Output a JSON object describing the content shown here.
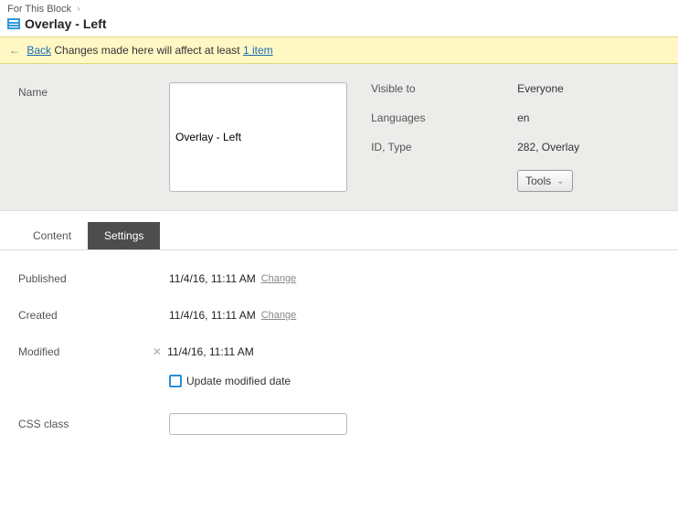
{
  "breadcrumb": {
    "root": "For This Block"
  },
  "page_title": "Overlay - Left",
  "notice": {
    "back_label": "Back",
    "message_prefix": "Changes made here will affect at least",
    "item_link": "1 item"
  },
  "name_field": {
    "label": "Name",
    "value": "Overlay - Left"
  },
  "meta": {
    "visible_label": "Visible to",
    "visible_value": "Everyone",
    "languages_label": "Languages",
    "languages_value": "en",
    "idtype_label": "ID, Type",
    "idtype_value": "282, Overlay"
  },
  "tools_label": "Tools",
  "tabs": {
    "content": "Content",
    "settings": "Settings"
  },
  "settings": {
    "published_label": "Published",
    "published_value": "11/4/16, 11:11 AM",
    "created_label": "Created",
    "created_value": "11/4/16, 11:11 AM",
    "modified_label": "Modified",
    "modified_value": "11/4/16, 11:11 AM",
    "change_link": "Change",
    "update_modified_label": "Update modified date",
    "css_label": "CSS class",
    "css_value": ""
  }
}
